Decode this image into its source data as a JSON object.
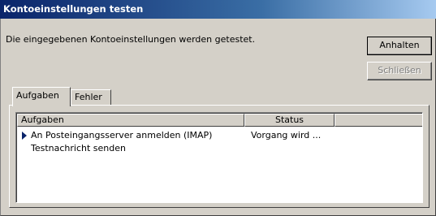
{
  "window": {
    "title": "Kontoeinstellungen testen"
  },
  "message": "Die eingegebenen Kontoeinstellungen werden getestet.",
  "buttons": {
    "stop": "Anhalten",
    "close": "Schließen"
  },
  "tabs": [
    {
      "label": "Aufgaben"
    },
    {
      "label": "Fehler"
    }
  ],
  "table": {
    "columns": [
      "Aufgaben",
      "Status",
      ""
    ],
    "rows": [
      {
        "task": "An Posteingangsserver anmelden (IMAP)",
        "status": "Vorgang wird ...",
        "current": true
      },
      {
        "task": "Testnachricht senden",
        "status": "",
        "current": false
      }
    ]
  },
  "colors": {
    "titlebar": "#0a246a",
    "face": "#d4d0c8",
    "arrow": "#0a246a"
  }
}
